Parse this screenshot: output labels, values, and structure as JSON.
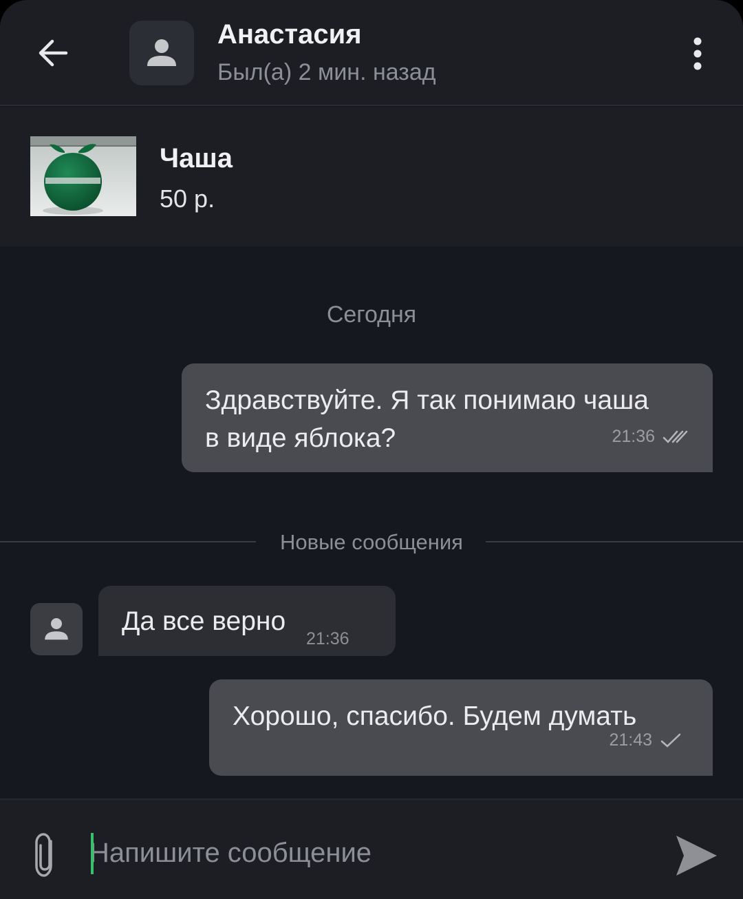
{
  "header": {
    "contact_name": "Анастасия",
    "status": "Был(а) 2 мин. назад"
  },
  "product": {
    "title": "Чаша",
    "price": "50 р."
  },
  "chat": {
    "date_label": "Сегодня",
    "new_messages_label": "Новые сообщения",
    "messages": [
      {
        "direction": "outgoing",
        "text": "Здравствуйте. Я так понимаю чаша в виде яблока?",
        "time": "21:36",
        "status": "read"
      },
      {
        "direction": "incoming",
        "text": "Да все верно",
        "time": "21:36"
      },
      {
        "direction": "outgoing",
        "text": "Хорошо, спасибо. Будем думать",
        "time": "21:43",
        "status": "sent"
      }
    ]
  },
  "composer": {
    "placeholder": "Напишите сообщение"
  },
  "icons": {
    "back": "arrow-left-icon",
    "menu": "more-vertical-icon",
    "avatar": "user-icon",
    "attach": "paperclip-icon",
    "send": "send-icon",
    "read": "double-check-icon",
    "sent": "check-icon"
  },
  "colors": {
    "background": "#161820",
    "header": "#1c1e24",
    "outgoing_bubble": "#4a4b50",
    "incoming_bubble": "#2c2e34",
    "caret": "#35c26a"
  }
}
